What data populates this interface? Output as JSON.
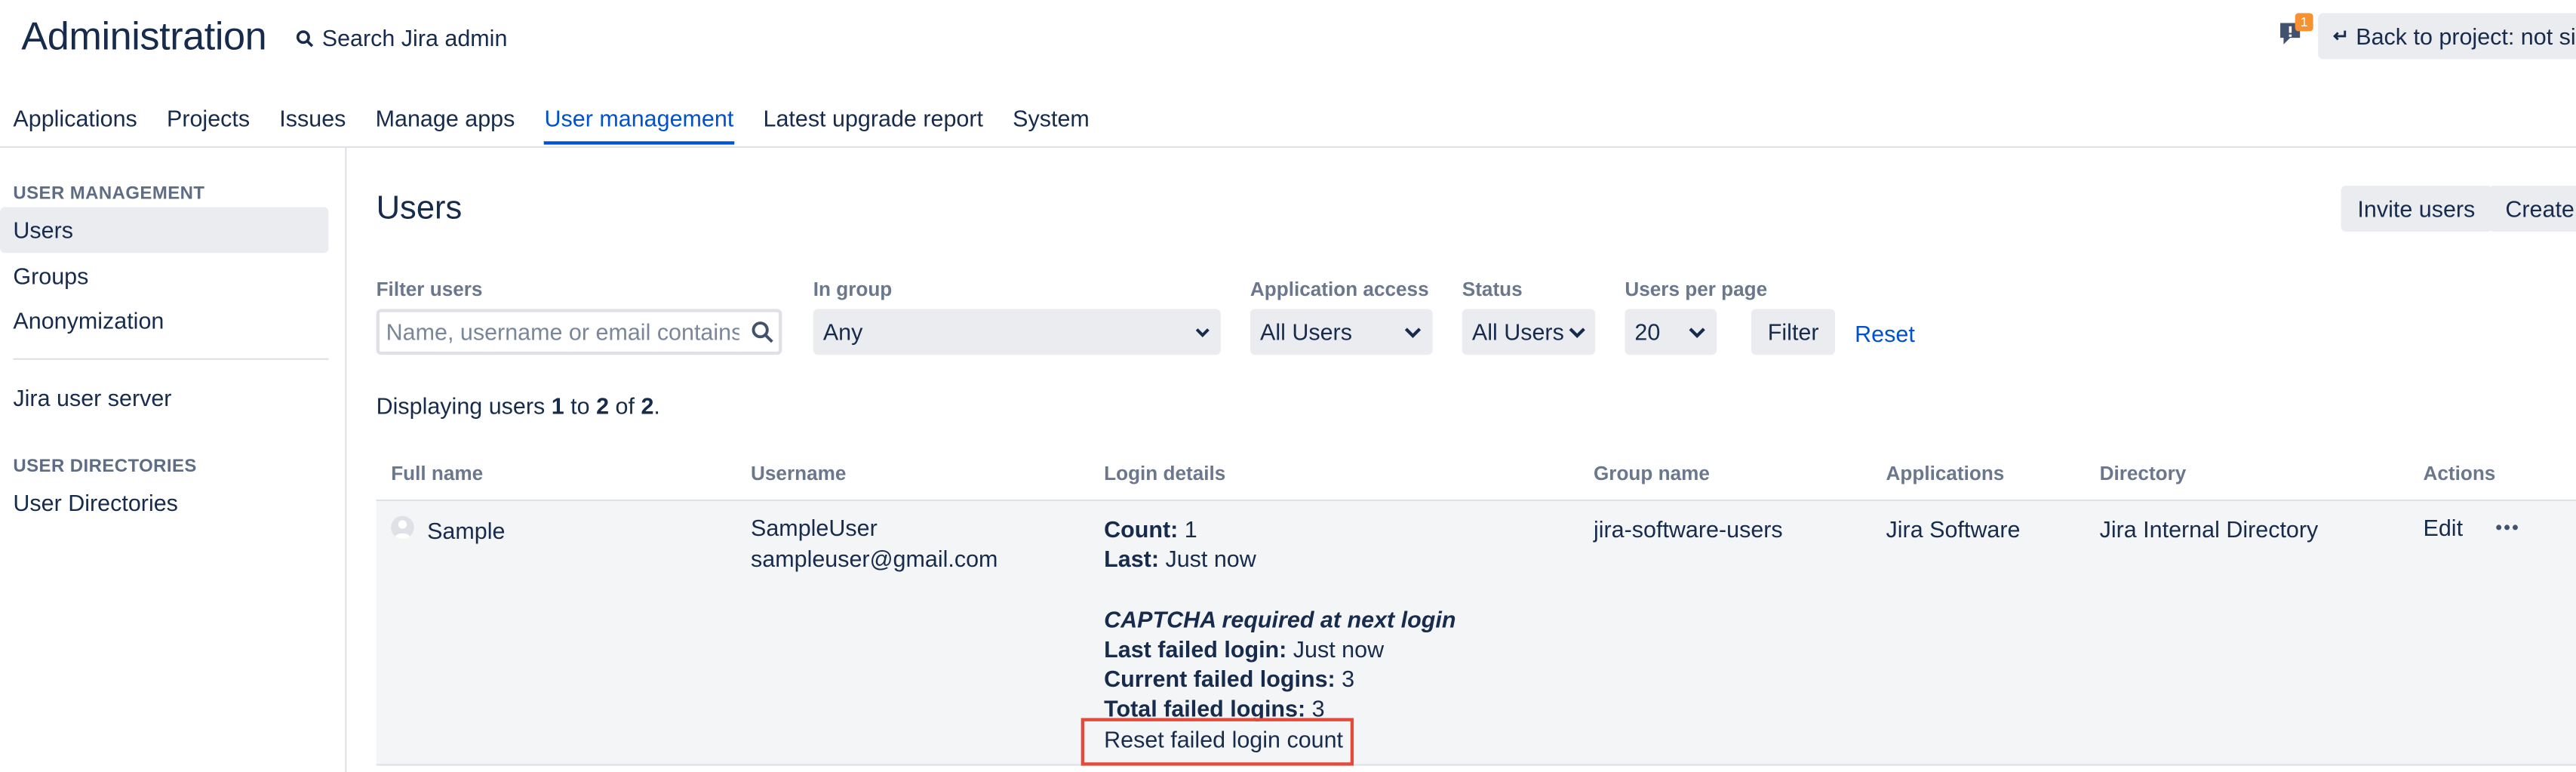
{
  "header": {
    "title": "Administration",
    "search_label": "Search Jira admin",
    "notification_count": "1",
    "back_label": "Back to project: not sim"
  },
  "topnav": {
    "tabs": [
      {
        "label": "Applications",
        "active": false
      },
      {
        "label": "Projects",
        "active": false
      },
      {
        "label": "Issues",
        "active": false
      },
      {
        "label": "Manage apps",
        "active": false
      },
      {
        "label": "User management",
        "active": true
      },
      {
        "label": "Latest upgrade report",
        "active": false
      },
      {
        "label": "System",
        "active": false
      }
    ]
  },
  "sidebar": {
    "section1_heading": "USER MANAGEMENT",
    "items": [
      "Users",
      "Groups",
      "Anonymization"
    ],
    "item_jira_user_server": "Jira user server",
    "section2_heading": "USER DIRECTORIES",
    "item_user_directories": "User Directories",
    "active_item": "Users"
  },
  "main": {
    "title": "Users",
    "invite_button": "Invite users",
    "create_button": "Create user"
  },
  "filters": {
    "filter_users_label": "Filter users",
    "filter_users_placeholder": "Name, username or email contains",
    "in_group_label": "In group",
    "in_group_value": "Any",
    "app_access_label": "Application access",
    "app_access_value": "All Users",
    "status_label": "Status",
    "status_value": "All Users",
    "per_page_label": "Users per page",
    "per_page_value": "20",
    "filter_button": "Filter",
    "reset_link": "Reset"
  },
  "display": {
    "prefix": "Displaying users ",
    "from": "1",
    "to_word": " to ",
    "to": "2",
    "of_word": " of ",
    "total": "2",
    "suffix": "."
  },
  "table": {
    "headers": [
      "Full name",
      "Username",
      "Login details",
      "Group name",
      "Applications",
      "Directory",
      "Actions"
    ],
    "row": {
      "full_name": "Sample",
      "username": "SampleUser",
      "email": "sampleuser@gmail.com",
      "count_label": "Count:",
      "count_value": "1",
      "last_label": "Last:",
      "last_value": "Just now",
      "captcha": "CAPTCHA required at next login",
      "last_failed_label": "Last failed login:",
      "last_failed_value": "Just now",
      "current_failed_label": "Current failed logins:",
      "current_failed_value": "3",
      "total_failed_label": "Total failed logins:",
      "total_failed_value": "3",
      "reset_failed_link": "Reset failed login count",
      "group": "jira-software-users",
      "application": "Jira Software",
      "directory": "Jira Internal Directory",
      "edit_link": "Edit"
    }
  },
  "colors": {
    "link": "#0052cc",
    "highlight_box": "#e5493a",
    "notification_badge": "#f79232"
  }
}
